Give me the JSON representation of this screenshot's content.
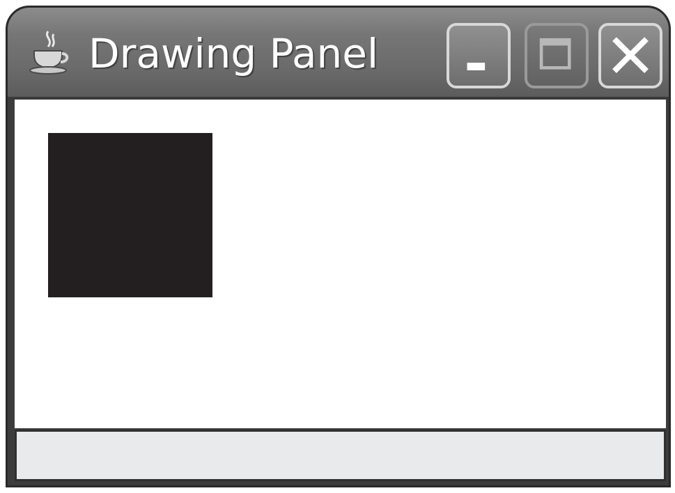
{
  "window": {
    "title": "Drawing Panel",
    "icon": "java-coffee-cup-icon",
    "controls": {
      "minimize_icon": "minimize-icon",
      "maximize_icon": "maximize-icon",
      "close_icon": "close-icon"
    }
  },
  "canvas": {
    "background_color": "#ffffff",
    "square_color": "#231f20"
  },
  "status_bar": {
    "text": ""
  }
}
